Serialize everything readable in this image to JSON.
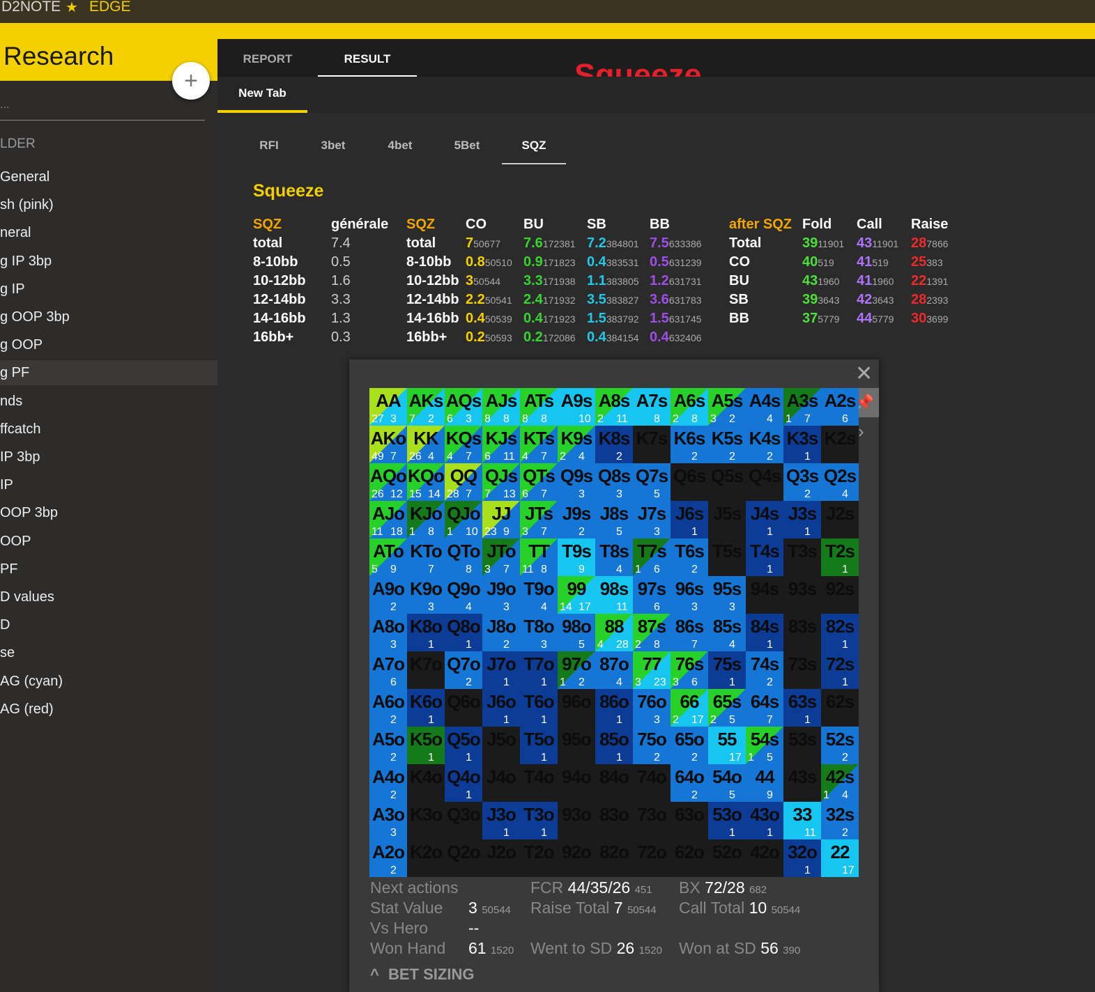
{
  "topbar": {
    "brand": "D2NOTE",
    "star": "★",
    "edge": "EDGE"
  },
  "sidebar": {
    "title": "Research",
    "add": "+",
    "search_placeholder": "...",
    "folder_label": "LDER",
    "items": [
      "General",
      "sh (pink)",
      "neral",
      "g IP 3bp",
      "g IP",
      "g OOP 3bp",
      "g OOP",
      "g PF",
      "nds",
      "ffcatch",
      " IP 3bp",
      " IP",
      " OOP 3bp",
      " OOP",
      " PF",
      "D values",
      "D",
      "se",
      "AG (cyan)",
      "AG (red)"
    ],
    "active_index": 7
  },
  "main_tabs": [
    "REPORT",
    "RESULT"
  ],
  "overlay_title": "Squeeze",
  "open_tab": "New Tab",
  "stat_tabs": [
    "RFI",
    "3bet",
    "4bet",
    "5Bet",
    "SQZ"
  ],
  "section_title": "Squeeze",
  "table1": {
    "headers": [
      "SQZ",
      "générale"
    ],
    "rows": [
      [
        "total",
        "7.4"
      ],
      [
        "8-10bb",
        "0.5"
      ],
      [
        "10-12bb",
        "1.6"
      ],
      [
        "12-14bb",
        "3.3"
      ],
      [
        "14-16bb",
        "1.3"
      ],
      [
        "16bb+",
        "0.3"
      ]
    ]
  },
  "table2": {
    "headers": [
      "SQZ",
      "CO",
      "BU",
      "SB",
      "BB"
    ],
    "labels": [
      "total",
      "8-10bb",
      "10-12bb",
      "12-14bb",
      "14-16bb",
      "16bb+"
    ],
    "co": [
      [
        "7",
        "50677"
      ],
      [
        "0.8",
        "50510"
      ],
      [
        "3",
        "50544"
      ],
      [
        "2.2",
        "50541"
      ],
      [
        "0.4",
        "50539"
      ],
      [
        "0.2",
        "50593"
      ]
    ],
    "bu": [
      [
        "7.6",
        "172381"
      ],
      [
        "0.9",
        "171823"
      ],
      [
        "3.3",
        "171938"
      ],
      [
        "2.4",
        "171932"
      ],
      [
        "0.4",
        "171923"
      ],
      [
        "0.2",
        "172086"
      ]
    ],
    "sb": [
      [
        "7.2",
        "384801"
      ],
      [
        "0.4",
        "383531"
      ],
      [
        "1.1",
        "383805"
      ],
      [
        "3.5",
        "383827"
      ],
      [
        "1.5",
        "383792"
      ],
      [
        "0.4",
        "384154"
      ]
    ],
    "bb": [
      [
        "7.5",
        "633386"
      ],
      [
        "0.5",
        "631239"
      ],
      [
        "1.2",
        "631731"
      ],
      [
        "3.6",
        "631783"
      ],
      [
        "1.5",
        "631745"
      ],
      [
        "0.4",
        "632406"
      ]
    ]
  },
  "table3": {
    "headers": [
      "after SQZ",
      "Fold",
      "Call",
      "Raise"
    ],
    "labels": [
      "Total",
      "CO",
      "BU",
      "SB",
      "BB"
    ],
    "fold": [
      [
        "39",
        "11901"
      ],
      [
        "40",
        "519"
      ],
      [
        "43",
        "1960"
      ],
      [
        "39",
        "3643"
      ],
      [
        "37",
        "5779"
      ]
    ],
    "call": [
      [
        "43",
        "11901"
      ],
      [
        "41",
        "519"
      ],
      [
        "41",
        "1960"
      ],
      [
        "42",
        "3643"
      ],
      [
        "44",
        "5779"
      ]
    ],
    "raise": [
      [
        "28",
        "7866"
      ],
      [
        "25",
        "383"
      ],
      [
        "22",
        "1391"
      ],
      [
        "28",
        "2393"
      ],
      [
        "30",
        "3699"
      ]
    ]
  },
  "popup": {
    "close": "✕",
    "pin": "📌",
    "chevron": "›",
    "grid": [
      [
        [
          "AA",
          "27",
          "3",
          "lime-cyan"
        ],
        [
          "AKs",
          "7",
          "2",
          "green-cyan"
        ],
        [
          "AQs",
          "6",
          "3",
          "green-cyan"
        ],
        [
          "AJs",
          "8",
          "8",
          "green-cyan"
        ],
        [
          "ATs",
          "8",
          "8",
          "green-cyan"
        ],
        [
          "A9s",
          "",
          "10",
          "cyan"
        ],
        [
          "A8s",
          "2",
          "11",
          "green-cyan"
        ],
        [
          "A7s",
          "",
          "8",
          "cyan"
        ],
        [
          "A6s",
          "2",
          "8",
          "green-cyan"
        ],
        [
          "A5s",
          "3",
          "2",
          "green-blue"
        ],
        [
          "A4s",
          "",
          "4",
          "blue"
        ],
        [
          "A3s",
          "1",
          "7",
          "dkgreen-blue"
        ],
        [
          "A2s",
          "",
          "6",
          "blue"
        ]
      ],
      [
        [
          "AKo",
          "49",
          "7",
          "lime-blue"
        ],
        [
          "KK",
          "26",
          "4",
          "lime-blue"
        ],
        [
          "KQs",
          "4",
          "7",
          "green-blue"
        ],
        [
          "KJs",
          "6",
          "11",
          "green-blue"
        ],
        [
          "KTs",
          "4",
          "7",
          "green-blue"
        ],
        [
          "K9s",
          "2",
          "4",
          "green-blue"
        ],
        [
          "K8s",
          "",
          "2",
          "navy"
        ],
        [
          "K7s",
          "",
          "",
          "dark"
        ],
        [
          "K6s",
          "",
          "2",
          "blue"
        ],
        [
          "K5s",
          "",
          "2",
          "blue"
        ],
        [
          "K4s",
          "",
          "2",
          "blue"
        ],
        [
          "K3s",
          "",
          "1",
          "navy"
        ],
        [
          "K2s",
          "",
          "",
          "dark"
        ]
      ],
      [
        [
          "AQo",
          "26",
          "12",
          "green-blue"
        ],
        [
          "KQo",
          "15",
          "14",
          "green-blue"
        ],
        [
          "QQ",
          "28",
          "7",
          "lime-blue"
        ],
        [
          "QJs",
          "7",
          "13",
          "green-blue"
        ],
        [
          "QTs",
          "6",
          "7",
          "green-blue"
        ],
        [
          "Q9s",
          "",
          "3",
          "blue"
        ],
        [
          "Q8s",
          "",
          "3",
          "blue"
        ],
        [
          "Q7s",
          "",
          "5",
          "blue"
        ],
        [
          "Q6s",
          "",
          "",
          "dark"
        ],
        [
          "Q5s",
          "",
          "",
          "dark"
        ],
        [
          "Q4s",
          "",
          "",
          "dark"
        ],
        [
          "Q3s",
          "",
          "2",
          "blue"
        ],
        [
          "Q2s",
          "",
          "4",
          "blue"
        ]
      ],
      [
        [
          "AJo",
          "11",
          "18",
          "green-blue"
        ],
        [
          "KJo",
          "1",
          "8",
          "dkgreen-blue"
        ],
        [
          "QJo",
          "1",
          "10",
          "dkgreen-blue"
        ],
        [
          "JJ",
          "23",
          "9",
          "lime-blue"
        ],
        [
          "JTs",
          "3",
          "7",
          "green-blue"
        ],
        [
          "J9s",
          "",
          "2",
          "blue"
        ],
        [
          "J8s",
          "",
          "5",
          "blue"
        ],
        [
          "J7s",
          "",
          "3",
          "blue"
        ],
        [
          "J6s",
          "",
          "1",
          "navy"
        ],
        [
          "J5s",
          "",
          "",
          "dark"
        ],
        [
          "J4s",
          "",
          "1",
          "navy"
        ],
        [
          "J3s",
          "",
          "1",
          "navy"
        ],
        [
          "J2s",
          "",
          "",
          "dark"
        ]
      ],
      [
        [
          "ATo",
          "5",
          "9",
          "green-blue"
        ],
        [
          "KTo",
          "",
          "7",
          "blue"
        ],
        [
          "QTo",
          "",
          "8",
          "blue"
        ],
        [
          "JTo",
          "3",
          "7",
          "dkgreen-blue"
        ],
        [
          "TT",
          "11",
          "8",
          "green-blue"
        ],
        [
          "T9s",
          "",
          "9",
          "cyan"
        ],
        [
          "T8s",
          "",
          "4",
          "blue"
        ],
        [
          "T7s",
          "1",
          "6",
          "dkgreen-blue"
        ],
        [
          "T6s",
          "",
          "2",
          "blue"
        ],
        [
          "T5s",
          "",
          "",
          "dark"
        ],
        [
          "T4s",
          "",
          "1",
          "navy"
        ],
        [
          "T3s",
          "",
          "",
          "dark"
        ],
        [
          "T2s",
          "",
          "1",
          "dkgreen"
        ]
      ],
      [
        [
          "A9o",
          "",
          "2",
          "blue"
        ],
        [
          "K9o",
          "",
          "3",
          "blue"
        ],
        [
          "Q9o",
          "",
          "4",
          "blue"
        ],
        [
          "J9o",
          "",
          "3",
          "blue"
        ],
        [
          "T9o",
          "",
          "4",
          "blue"
        ],
        [
          "99",
          "14",
          "17",
          "green-cyan"
        ],
        [
          "98s",
          "",
          "11",
          "cyan"
        ],
        [
          "97s",
          "",
          "6",
          "blue"
        ],
        [
          "96s",
          "",
          "3",
          "blue"
        ],
        [
          "95s",
          "",
          "3",
          "blue"
        ],
        [
          "94s",
          "",
          "",
          "dark"
        ],
        [
          "93s",
          "",
          "",
          "dark"
        ],
        [
          "92s",
          "",
          "",
          "dark"
        ]
      ],
      [
        [
          "A8o",
          "",
          "3",
          "blue"
        ],
        [
          "K8o",
          "",
          "1",
          "navy"
        ],
        [
          "Q8o",
          "",
          "1",
          "navy"
        ],
        [
          "J8o",
          "",
          "2",
          "blue"
        ],
        [
          "T8o",
          "",
          "3",
          "blue"
        ],
        [
          "98o",
          "",
          "5",
          "blue"
        ],
        [
          "88",
          "4",
          "28",
          "green-cyan"
        ],
        [
          "87s",
          "2",
          "8",
          "green-blue"
        ],
        [
          "86s",
          "",
          "7",
          "blue"
        ],
        [
          "85s",
          "",
          "4",
          "blue"
        ],
        [
          "84s",
          "",
          "1",
          "navy"
        ],
        [
          "83s",
          "",
          "",
          "dark"
        ],
        [
          "82s",
          "",
          "1",
          "navy"
        ]
      ],
      [
        [
          "A7o",
          "",
          "6",
          "blue"
        ],
        [
          "K7o",
          "",
          "",
          "dark"
        ],
        [
          "Q7o",
          "",
          "2",
          "blue"
        ],
        [
          "J7o",
          "",
          "1",
          "navy"
        ],
        [
          "T7o",
          "",
          "1",
          "navy"
        ],
        [
          "97o",
          "1",
          "2",
          "dkgreen-blue"
        ],
        [
          "87o",
          "",
          "4",
          "blue"
        ],
        [
          "77",
          "3",
          "23",
          "green-cyan"
        ],
        [
          "76s",
          "3",
          "6",
          "green-blue"
        ],
        [
          "75s",
          "",
          "1",
          "navy"
        ],
        [
          "74s",
          "",
          "2",
          "blue"
        ],
        [
          "73s",
          "",
          "",
          "dark"
        ],
        [
          "72s",
          "",
          "1",
          "navy"
        ]
      ],
      [
        [
          "A6o",
          "",
          "2",
          "blue"
        ],
        [
          "K6o",
          "",
          "1",
          "navy"
        ],
        [
          "Q6o",
          "",
          "",
          "dark"
        ],
        [
          "J6o",
          "",
          "1",
          "navy"
        ],
        [
          "T6o",
          "",
          "1",
          "navy"
        ],
        [
          "96o",
          "",
          "",
          "dark"
        ],
        [
          "86o",
          "",
          "1",
          "navy"
        ],
        [
          "76o",
          "",
          "3",
          "blue"
        ],
        [
          "66",
          "2",
          "17",
          "green-cyan"
        ],
        [
          "65s",
          "2",
          "5",
          "green-blue"
        ],
        [
          "64s",
          "",
          "7",
          "blue"
        ],
        [
          "63s",
          "",
          "1",
          "navy"
        ],
        [
          "62s",
          "",
          "",
          "dark"
        ]
      ],
      [
        [
          "A5o",
          "",
          "2",
          "blue"
        ],
        [
          "K5o",
          "",
          "1",
          "dkgreen"
        ],
        [
          "Q5o",
          "",
          "1",
          "navy"
        ],
        [
          "J5o",
          "",
          "",
          "dark"
        ],
        [
          "T5o",
          "",
          "1",
          "navy"
        ],
        [
          "95o",
          "",
          "",
          "dark"
        ],
        [
          "85o",
          "",
          "1",
          "navy"
        ],
        [
          "75o",
          "",
          "2",
          "blue"
        ],
        [
          "65o",
          "",
          "2",
          "blue"
        ],
        [
          "55",
          "",
          "17",
          "cyan"
        ],
        [
          "54s",
          "1",
          "5",
          "green-blue"
        ],
        [
          "53s",
          "",
          "",
          "dark"
        ],
        [
          "52s",
          "",
          "2",
          "blue"
        ]
      ],
      [
        [
          "A4o",
          "",
          "2",
          "blue"
        ],
        [
          "K4o",
          "",
          "",
          "dark"
        ],
        [
          "Q4o",
          "",
          "1",
          "navy"
        ],
        [
          "J4o",
          "",
          "",
          "dark"
        ],
        [
          "T4o",
          "",
          "",
          "dark"
        ],
        [
          "94o",
          "",
          "",
          "dark"
        ],
        [
          "84o",
          "",
          "",
          "dark"
        ],
        [
          "74o",
          "",
          "",
          "dark"
        ],
        [
          "64o",
          "",
          "2",
          "blue"
        ],
        [
          "54o",
          "",
          "5",
          "blue"
        ],
        [
          "44",
          "",
          "9",
          "blue"
        ],
        [
          "43s",
          "",
          "",
          "dark"
        ],
        [
          "42s",
          "1",
          "4",
          "dkgreen-blue"
        ]
      ],
      [
        [
          "A3o",
          "",
          "3",
          "blue"
        ],
        [
          "K3o",
          "",
          "",
          "dark"
        ],
        [
          "Q3o",
          "",
          "",
          "dark"
        ],
        [
          "J3o",
          "",
          "1",
          "navy"
        ],
        [
          "T3o",
          "",
          "1",
          "navy"
        ],
        [
          "93o",
          "",
          "",
          "dark"
        ],
        [
          "83o",
          "",
          "",
          "dark"
        ],
        [
          "73o",
          "",
          "",
          "dark"
        ],
        [
          "63o",
          "",
          "",
          "dark"
        ],
        [
          "53o",
          "",
          "1",
          "navy"
        ],
        [
          "43o",
          "",
          "1",
          "navy"
        ],
        [
          "33",
          "",
          "11",
          "cyan"
        ],
        [
          "32s",
          "",
          "2",
          "blue"
        ]
      ],
      [
        [
          "A2o",
          "",
          "2",
          "blue"
        ],
        [
          "K2o",
          "",
          "",
          "dark"
        ],
        [
          "Q2o",
          "",
          "",
          "dark"
        ],
        [
          "J2o",
          "",
          "",
          "dark"
        ],
        [
          "T2o",
          "",
          "",
          "dark"
        ],
        [
          "92o",
          "",
          "",
          "dark"
        ],
        [
          "82o",
          "",
          "",
          "dark"
        ],
        [
          "72o",
          "",
          "",
          "dark"
        ],
        [
          "62o",
          "",
          "",
          "dark"
        ],
        [
          "52o",
          "",
          "",
          "dark"
        ],
        [
          "42o",
          "",
          "",
          "dark"
        ],
        [
          "32o",
          "",
          "1",
          "navy"
        ],
        [
          "22",
          "",
          "17",
          "cyan"
        ]
      ]
    ],
    "stats": {
      "next_actions": "Next actions",
      "fcr_label": "FCR",
      "fcr_value": "44/35/26",
      "fcr_n": "451",
      "bx_label": "BX",
      "bx_value": "72/28",
      "bx_n": "682",
      "stat_value_label": "Stat Value",
      "stat_value": "3",
      "stat_value_n": "50544",
      "raise_total_label": "Raise Total",
      "raise_total": "7",
      "raise_total_n": "50544",
      "call_total_label": "Call Total",
      "call_total": "10",
      "call_total_n": "50544",
      "vs_hero_label": "Vs Hero",
      "vs_hero": "--",
      "won_hand_label": "Won Hand",
      "won_hand": "61",
      "won_hand_n": "1520",
      "went_sd_label": "Went to SD",
      "went_sd": "26",
      "went_sd_n": "1520",
      "won_sd_label": "Won at SD",
      "won_sd": "56",
      "won_sd_n": "390"
    },
    "bet_sizing": "BET SIZING",
    "bet_sizing_icon": "^"
  },
  "colors": {
    "yellow": "#f5d000",
    "cyan": "#16c5f0",
    "blue": "#1676d6",
    "navy": "#0d3c96",
    "dark": "#1b1b1b",
    "green": "#28d12a",
    "lime": "#a8e01b",
    "dkgreen": "#157a1a"
  }
}
